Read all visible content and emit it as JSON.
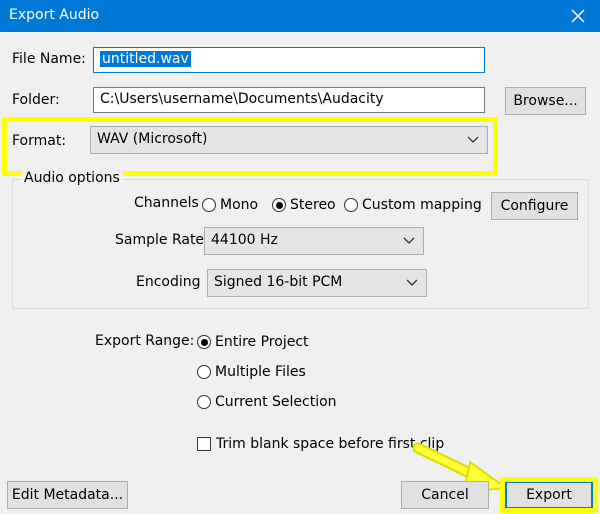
{
  "window": {
    "title": "Export Audio"
  },
  "file": {
    "name_label": "File Name:",
    "name_value": "untitled.wav",
    "folder_label": "Folder:",
    "folder_value": "C:\\Users\\username\\Documents\\Audacity",
    "browse_label": "Browse..."
  },
  "format": {
    "label": "Format:",
    "value": "WAV (Microsoft)"
  },
  "audio_options": {
    "caption": "Audio options",
    "channels_label": "Channels",
    "channel_options": [
      "Mono",
      "Stereo",
      "Custom mapping"
    ],
    "channel_selected": "Stereo",
    "configure_label": "Configure",
    "sample_rate_label": "Sample Rate",
    "sample_rate_value": "44100 Hz",
    "encoding_label": "Encoding",
    "encoding_value": "Signed 16-bit PCM"
  },
  "export_range": {
    "label": "Export Range:",
    "options": [
      "Entire Project",
      "Multiple Files",
      "Current Selection"
    ],
    "selected": "Entire Project",
    "trim_label": "Trim blank space before first clip",
    "trim_checked": false
  },
  "footer": {
    "edit_metadata_label": "Edit Metadata...",
    "cancel_label": "Cancel",
    "export_label": "Export"
  },
  "colors": {
    "titlebar": "#0078d7",
    "highlight": "#ffff00",
    "background": "#f0f0f0"
  }
}
